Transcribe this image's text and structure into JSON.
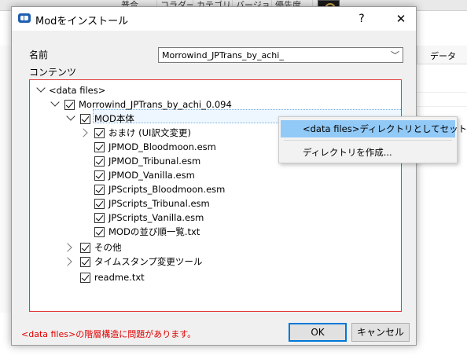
{
  "background": {
    "columns": [
      "普合",
      "コラダー",
      "カテゴリ",
      "バージョン",
      "優先度"
    ],
    "header_right": "データ"
  },
  "dialog": {
    "title": "Modをインストール",
    "help": "?",
    "close": "✕",
    "name_label": "名前",
    "name_value": "Morrowind_JPTrans_by_achi_",
    "contents_label": "コンテンツ",
    "error": "<data files>の階層構造に問題があります。",
    "ok": "OK",
    "cancel": "キャンセル"
  },
  "tree": [
    {
      "label": "<data files>",
      "expander": "open",
      "checkbox": false
    },
    {
      "label": "Morrowind_JPTrans_by_achi_0.094",
      "expander": "open",
      "checkbox": true
    },
    {
      "label": "MOD本体",
      "expander": "open",
      "checkbox": true,
      "selected": true
    },
    {
      "label": "おまけ (UI訳文変更)",
      "expander": "closed",
      "checkbox": true
    },
    {
      "label": "JPMOD_Bloodmoon.esm",
      "expander": "none",
      "checkbox": true
    },
    {
      "label": "JPMOD_Tribunal.esm",
      "expander": "none",
      "checkbox": true
    },
    {
      "label": "JPMOD_Vanilla.esm",
      "expander": "none",
      "checkbox": true
    },
    {
      "label": "JPScripts_Bloodmoon.esm",
      "expander": "none",
      "checkbox": true
    },
    {
      "label": "JPScripts_Tribunal.esm",
      "expander": "none",
      "checkbox": true
    },
    {
      "label": "JPScripts_Vanilla.esm",
      "expander": "none",
      "checkbox": true
    },
    {
      "label": "MODの並び順一覧.txt",
      "expander": "none",
      "checkbox": true
    },
    {
      "label": "その他",
      "expander": "closed",
      "checkbox": true
    },
    {
      "label": "タイムスタンプ変更ツール",
      "expander": "closed",
      "checkbox": true
    },
    {
      "label": "readme.txt",
      "expander": "none",
      "checkbox": true
    }
  ],
  "context_menu": {
    "items": [
      "<data files>ディレクトリとしてセット",
      "ディレクトリを作成..."
    ]
  }
}
